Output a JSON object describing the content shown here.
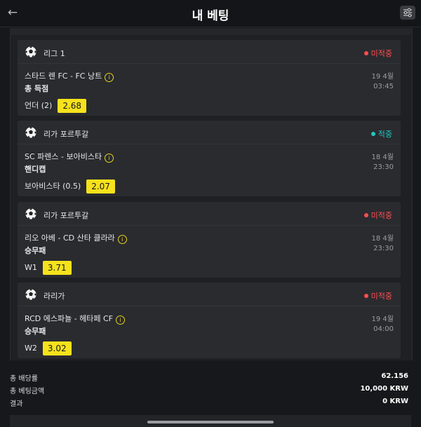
{
  "header": {
    "title": "내 베팅",
    "back_icon": "arrow-left-icon",
    "filter_icon": "sliders-icon"
  },
  "colors": {
    "odds_bg": "#f6e21c",
    "lost": "#ff4f4f",
    "won": "#22c8c0",
    "bg": "#17181b"
  },
  "bets": [
    {
      "league": "리그 1",
      "status": "미적중",
      "status_type": "lost",
      "match": "스타드 렌 FC - FC 낭트",
      "date": "19 4월",
      "market": "총 득점",
      "time": "03:45",
      "selection": "언더 (2)",
      "odds": "2.68"
    },
    {
      "league": "리가 포르투갈",
      "status": "적중",
      "status_type": "won",
      "match": "SC 파렌스 - 보아비스타",
      "date": "18 4월",
      "market": "핸디캡",
      "time": "23:30",
      "selection": "보아비스타 (0.5)",
      "odds": "2.07"
    },
    {
      "league": "리가 포르투갈",
      "status": "미적중",
      "status_type": "lost",
      "match": "리오 아베 - CD 산타 클라라",
      "date": "18 4월",
      "market": "승무패",
      "time": "23:30",
      "selection": "W1",
      "odds": "3.71"
    },
    {
      "league": "라리가",
      "status": "미적중",
      "status_type": "lost",
      "match": "RCD 에스파뇰 - 헤타페 CF",
      "date": "19 4월",
      "market": "승무패",
      "time": "04:00",
      "selection": "W2",
      "odds": "3.02"
    }
  ],
  "summary": {
    "total_odds_label": "총 배당률",
    "total_odds_value": "62.156",
    "total_stake_label": "총 베팅금액",
    "total_stake_value": "10,000 KRW",
    "result_label": "결과",
    "result_value": "0 KRW"
  }
}
